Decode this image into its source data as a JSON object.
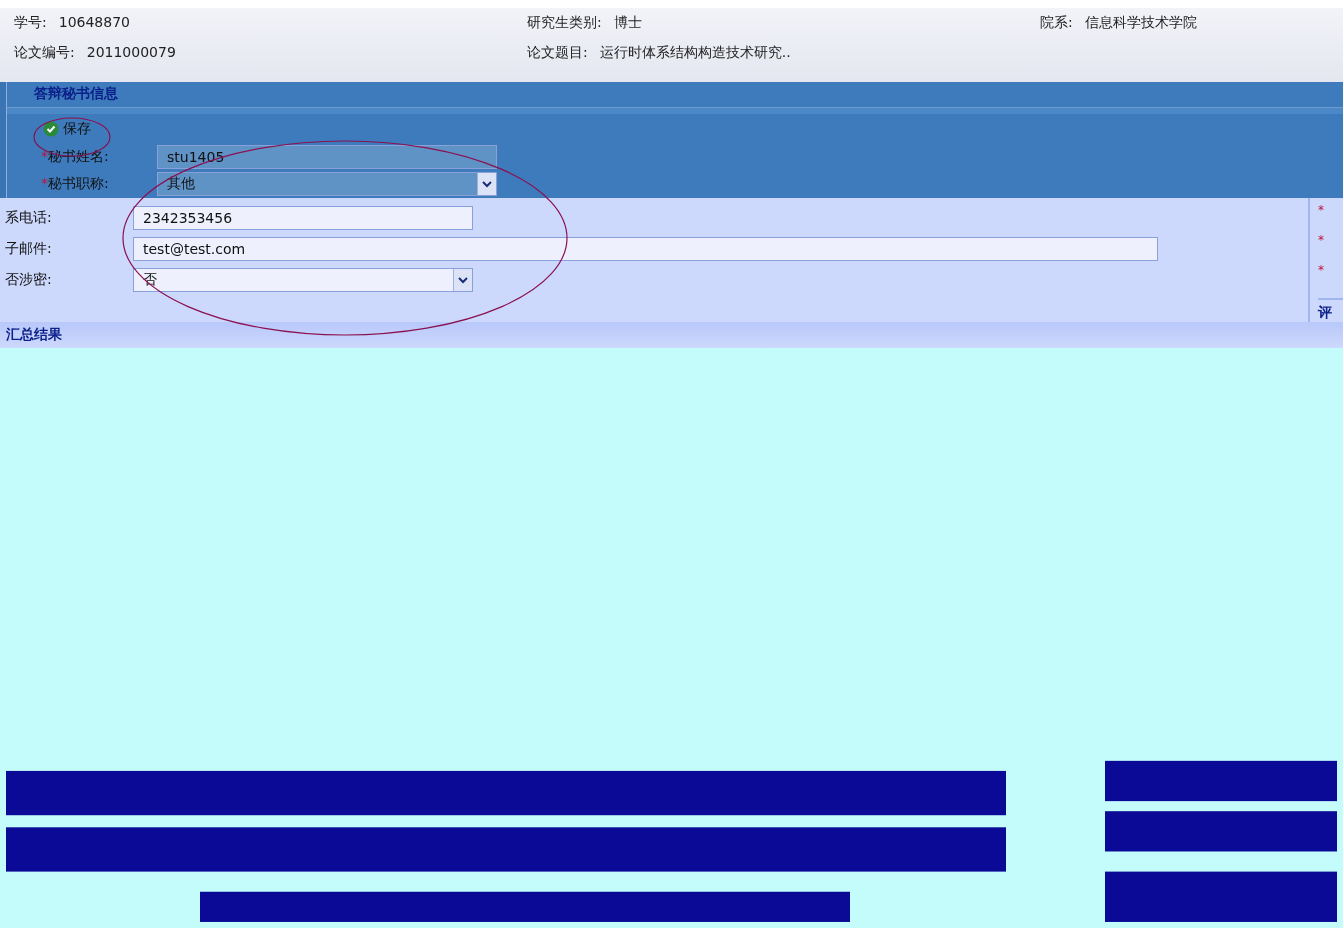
{
  "header": {
    "fields": [
      {
        "label": "学号:",
        "value": "10648870"
      },
      {
        "label": "研究生类别:",
        "value": "博士"
      },
      {
        "label": "院系:",
        "value": "信息科学技术学院"
      },
      {
        "label": "论文编号:",
        "value": "2011000079"
      },
      {
        "label": "论文题目:",
        "value": "运行时体系结构构造技术研究.."
      }
    ]
  },
  "secretary_panel": {
    "title": "答辩秘书信息",
    "toolbar": [
      {
        "label": "保存"
      }
    ],
    "fields": [
      {
        "mark": "*",
        "label": "秘书姓名:",
        "kind": "text",
        "value": "stu1405"
      },
      {
        "mark": "*",
        "label": "秘书职称:",
        "kind": "select",
        "value": "其他"
      }
    ]
  },
  "contact_panel": {
    "fields": [
      {
        "label": "系电话:",
        "kind": "text",
        "value": "2342353456"
      },
      {
        "label": "子邮件:",
        "kind": "wide",
        "value": "test@test.com"
      },
      {
        "label": "否涉密:",
        "kind": "select",
        "value": "否"
      }
    ]
  },
  "side_panel": {
    "marks": [
      "*",
      "*",
      "*"
    ],
    "title": "评"
  },
  "summary": {
    "title": "汇总结果"
  }
}
